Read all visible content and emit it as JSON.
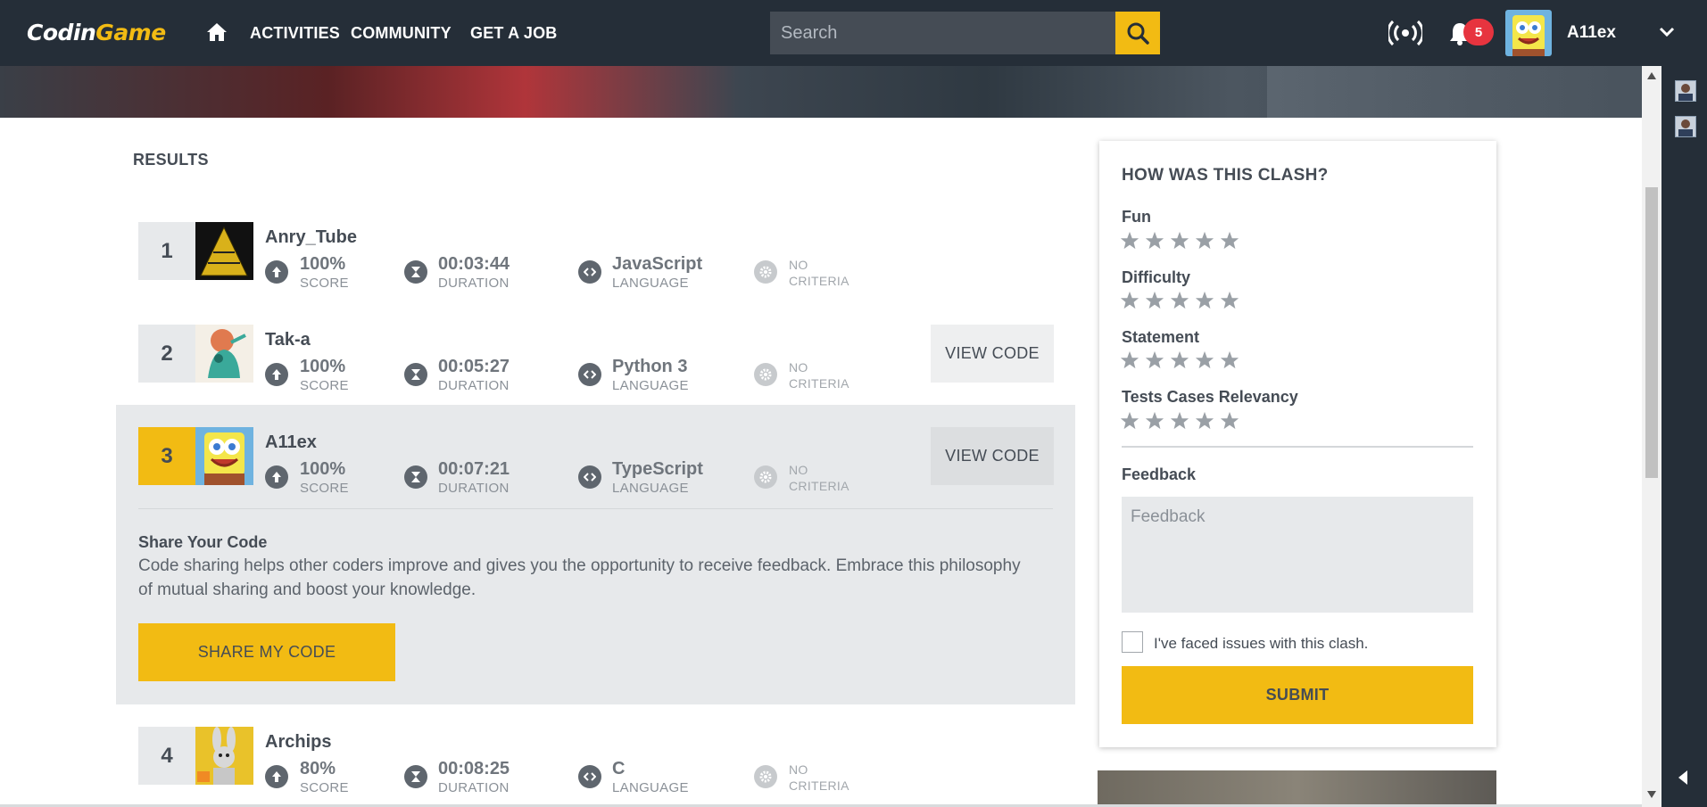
{
  "nav": {
    "logo_a": "Codin",
    "logo_b": "Game",
    "links": [
      "ACTIVITIES",
      "COMMUNITY",
      "GET A JOB"
    ],
    "search_placeholder": "Search",
    "notification_count": "5",
    "username": "A11ex"
  },
  "results": {
    "title": "RESULTS",
    "score_label": "SCORE",
    "duration_label": "DURATION",
    "language_label": "LANGUAGE",
    "criteria_line1": "NO",
    "criteria_line2": "CRITERIA",
    "view_code_label": "VIEW CODE",
    "rows": [
      {
        "rank": "1",
        "name": "Anry_Tube",
        "score": "100%",
        "duration": "00:03:44",
        "language": "JavaScript"
      },
      {
        "rank": "2",
        "name": "Tak-a",
        "score": "100%",
        "duration": "00:05:27",
        "language": "Python 3"
      },
      {
        "rank": "3",
        "name": "A11ex",
        "score": "100%",
        "duration": "00:07:21",
        "language": "TypeScript"
      },
      {
        "rank": "4",
        "name": "Archips",
        "score": "80%",
        "duration": "00:08:25",
        "language": "C"
      }
    ]
  },
  "share": {
    "title": "Share Your Code",
    "text": "Code sharing helps other coders improve and gives you the opportunity to receive feedback. Embrace this philosophy of mutual sharing and boost your knowledge.",
    "button": "SHARE MY CODE"
  },
  "feedback": {
    "title": "HOW WAS THIS CLASH?",
    "ratings": [
      "Fun",
      "Difficulty",
      "Statement",
      "Tests Cases Relevancy"
    ],
    "feedback_label": "Feedback",
    "feedback_placeholder": "Feedback",
    "issue_label": "I've faced issues with this clash.",
    "submit": "SUBMIT"
  },
  "colors": {
    "accent": "#f2bb13",
    "nav_bg": "#252e38",
    "badge": "#e7343f"
  }
}
